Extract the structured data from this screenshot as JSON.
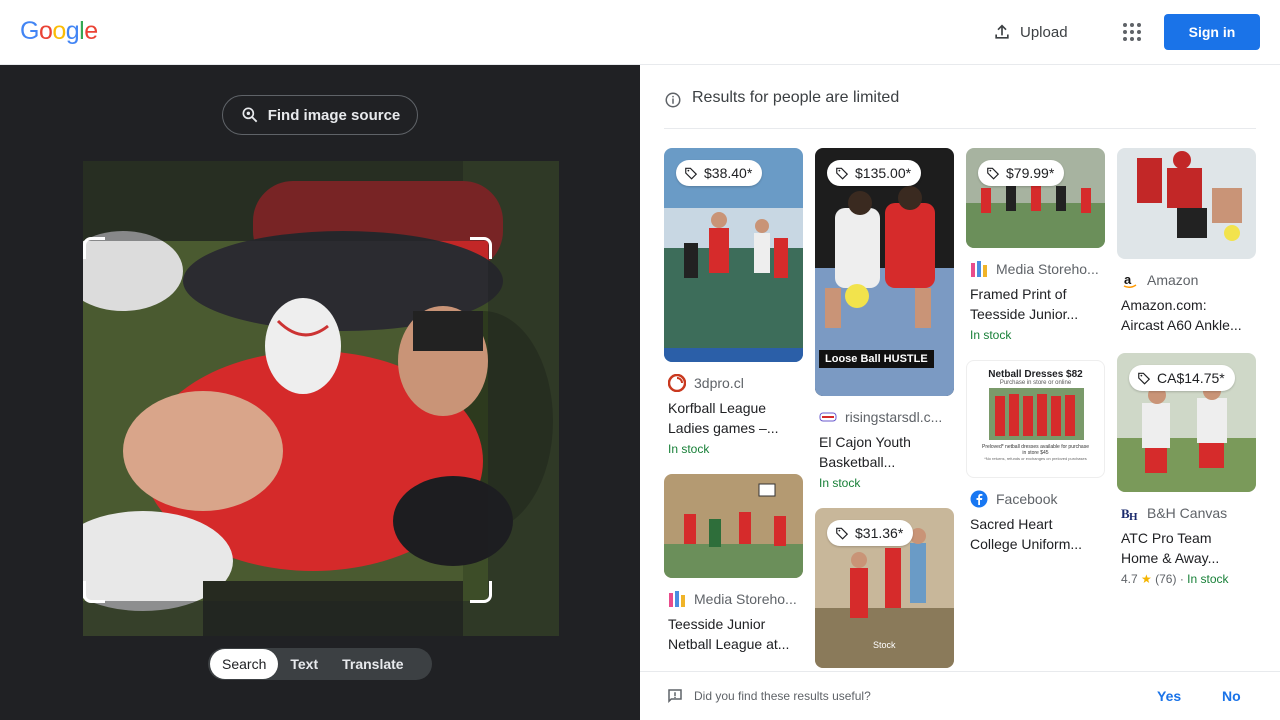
{
  "header": {
    "logo": [
      "G",
      "o",
      "o",
      "g",
      "l",
      "e"
    ],
    "logo_colors": [
      "#4285F4",
      "#EA4335",
      "#FBBC05",
      "#4285F4",
      "#34A853",
      "#EA4335"
    ],
    "upload_label": "Upload",
    "apps_icon": "apps-grid-icon",
    "signin_label": "Sign in"
  },
  "left": {
    "find_source_label": "Find image source",
    "modes": [
      "Search",
      "Text",
      "Translate"
    ],
    "active_mode": "Search"
  },
  "right": {
    "notice": "Results for people are limited",
    "results": {
      "col1": [
        {
          "price": "$38.40*",
          "source": "3dpro.cl",
          "title_1": "Korfball League",
          "title_2": "Ladies games –...",
          "stock": "In stock",
          "color": "#c9391f"
        },
        {
          "source": "Media Storeho...",
          "title_1": "Teesside Junior",
          "title_2": "Netball League at...",
          "color": "#6b8f3a"
        }
      ],
      "col2": [
        {
          "price": "$135.00*",
          "source": "risingstarsdl.c...",
          "title_1": "El Cajon Youth",
          "title_2": "Basketball...",
          "stock": "In stock",
          "banner": "Loose Ball HUSTLE"
        },
        {
          "price": "$31.36*",
          "stamp": "Stock"
        }
      ],
      "col3": [
        {
          "price": "$79.99*",
          "source": "Media Storeho...",
          "title_1": "Framed Print of",
          "title_2": "Teesside Junior...",
          "stock": "In stock"
        },
        {
          "poster_title": "Netball Dresses $82",
          "poster_sub": "Purchase in store or online",
          "poster_note": "Preloved* netball dresses available for purchase in store $45",
          "poster_fine": "*No returns, refunds or exchanges on preloved purchases",
          "source": "Facebook",
          "title_1": "Sacred Heart",
          "title_2": "College Uniform..."
        }
      ],
      "col4": [
        {
          "source": "Amazon",
          "title_1": "Amazon.com:",
          "title_2": "Aircast A60 Ankle..."
        },
        {
          "price": "CA$14.75*",
          "source": "B&H Canvas",
          "title_1": "ATC Pro Team",
          "title_2": "Home & Away...",
          "rating": "4.7",
          "reviews": "(76)",
          "stock": "In stock"
        }
      ]
    },
    "feedback": {
      "question": "Did you find these results useful?",
      "yes": "Yes",
      "no": "No"
    }
  }
}
